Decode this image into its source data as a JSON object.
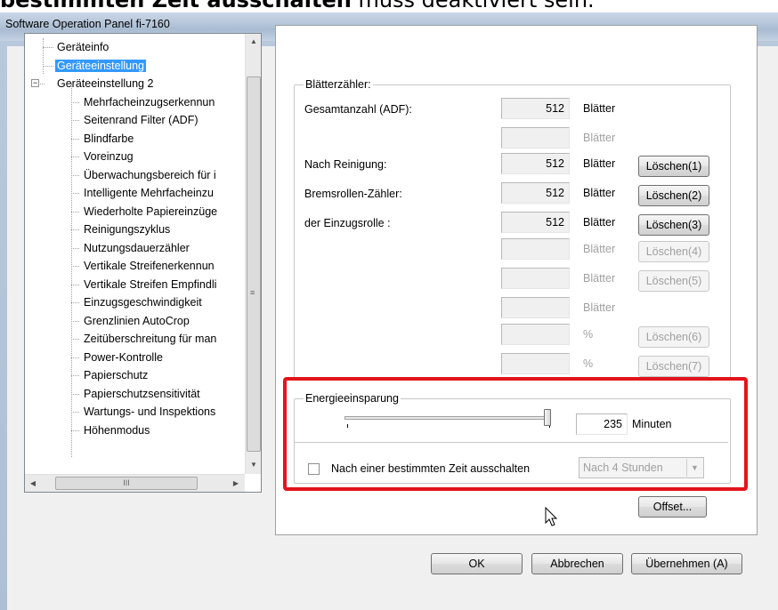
{
  "heading": {
    "bold_text": "bestimmten Zeit ausschalten",
    "rest_text": " muss deaktiviert sein."
  },
  "window": {
    "title": "Software Operation Panel fi-7160"
  },
  "tree": {
    "items": [
      {
        "label": "Geräteinfo",
        "selected": false
      },
      {
        "label": "Geräteeinstellung",
        "selected": true
      },
      {
        "label": "Geräteeinstellung 2",
        "selected": false
      },
      {
        "label": "Mehrfacheinzugserkennun",
        "selected": false
      },
      {
        "label": "Seitenrand Filter (ADF)",
        "selected": false
      },
      {
        "label": "Blindfarbe",
        "selected": false
      },
      {
        "label": "Voreinzug",
        "selected": false
      },
      {
        "label": "Überwachungsbereich für i",
        "selected": false
      },
      {
        "label": "Intelligente Mehrfacheinzu",
        "selected": false
      },
      {
        "label": "Wiederholte Papiereinzüge",
        "selected": false
      },
      {
        "label": "Reinigungszyklus",
        "selected": false
      },
      {
        "label": "Nutzungsdauerzähler",
        "selected": false
      },
      {
        "label": "Vertikale Streifenerkennun",
        "selected": false
      },
      {
        "label": "Vertikale Streifen Empfindli",
        "selected": false
      },
      {
        "label": "Einzugsgeschwindigkeit",
        "selected": false
      },
      {
        "label": "Grenzlinien AutoCrop",
        "selected": false
      },
      {
        "label": "Zeitüberschreitung für man",
        "selected": false
      },
      {
        "label": "Power-Kontrolle",
        "selected": false
      },
      {
        "label": "Papierschutz",
        "selected": false
      },
      {
        "label": "Papierschutzsensitivität",
        "selected": false
      },
      {
        "label": "Wartungs- und Inspektions",
        "selected": false
      },
      {
        "label": "Höhenmodus",
        "selected": false
      }
    ],
    "expander_symbol": "−",
    "hscroll_grip": "III",
    "vscroll_grip": "≡"
  },
  "counters": {
    "legend": "Blätterzähler:",
    "rows": [
      {
        "label": "Gesamtanzahl (ADF):",
        "value": "512",
        "unit": "Blätter",
        "button": ""
      },
      {
        "label": "",
        "value": "",
        "unit": "Blätter",
        "button": ""
      },
      {
        "label": "Nach Reinigung:",
        "value": "512",
        "unit": "Blätter",
        "button": "Löschen(1)"
      },
      {
        "label": "Bremsrollen-Zähler:",
        "value": "512",
        "unit": "Blätter",
        "button": "Löschen(2)"
      },
      {
        "label": "der Einzugsrolle :",
        "value": "512",
        "unit": "Blätter",
        "button": "Löschen(3)"
      },
      {
        "label": "",
        "value": "",
        "unit": "Blätter",
        "button": "Löschen(4)"
      },
      {
        "label": "",
        "value": "",
        "unit": "Blätter",
        "button": "Löschen(5)"
      },
      {
        "label": "",
        "value": "",
        "unit": "Blätter",
        "button": ""
      },
      {
        "label": "",
        "value": "",
        "unit": "%",
        "button": "Löschen(6)"
      },
      {
        "label": "",
        "value": "",
        "unit": "%",
        "button": "Löschen(7)"
      }
    ]
  },
  "energy": {
    "legend": "Energieeinsparung",
    "slider_level": 1.0,
    "value": "235",
    "unit": "Minuten",
    "checkbox_label": "Nach einer bestimmten Zeit ausschalten",
    "checkbox_checked": false,
    "dropdown_value": "Nach 4 Stunden"
  },
  "buttons": {
    "offset": "Offset...",
    "ok": "OK",
    "cancel": "Abbrechen",
    "apply": "Übernehmen (A)"
  },
  "colors": {
    "highlight": "#e3141b",
    "selection": "#3399ff"
  }
}
